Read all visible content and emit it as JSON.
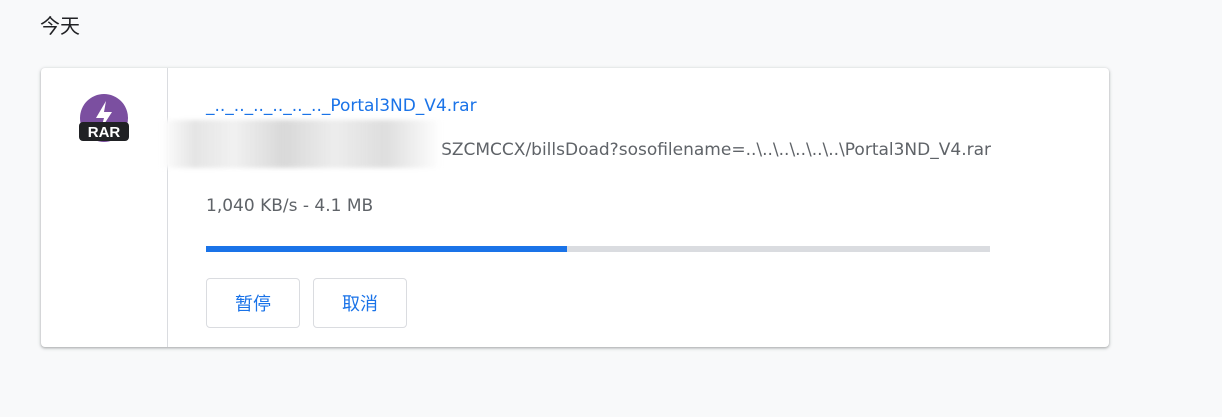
{
  "section": {
    "date_label": "今天"
  },
  "download": {
    "icon": "rar-archive-icon",
    "file_name": "_.._.._.._.._.._.._Portal3ND_V4.rar",
    "url_visible_tail": "SZCMCCX/billsDoad?sosofilename=..\\..\\..\\..\\..\\..\\Portal3ND_V4.rar",
    "status": "1,040 KB/s - 4.1 MB",
    "progress_fraction": 0.46,
    "pause_label": "暂停",
    "cancel_label": "取消"
  },
  "colors": {
    "accent": "#1a73e8",
    "icon_purple": "#7b4fa0",
    "track": "#dadce0"
  }
}
